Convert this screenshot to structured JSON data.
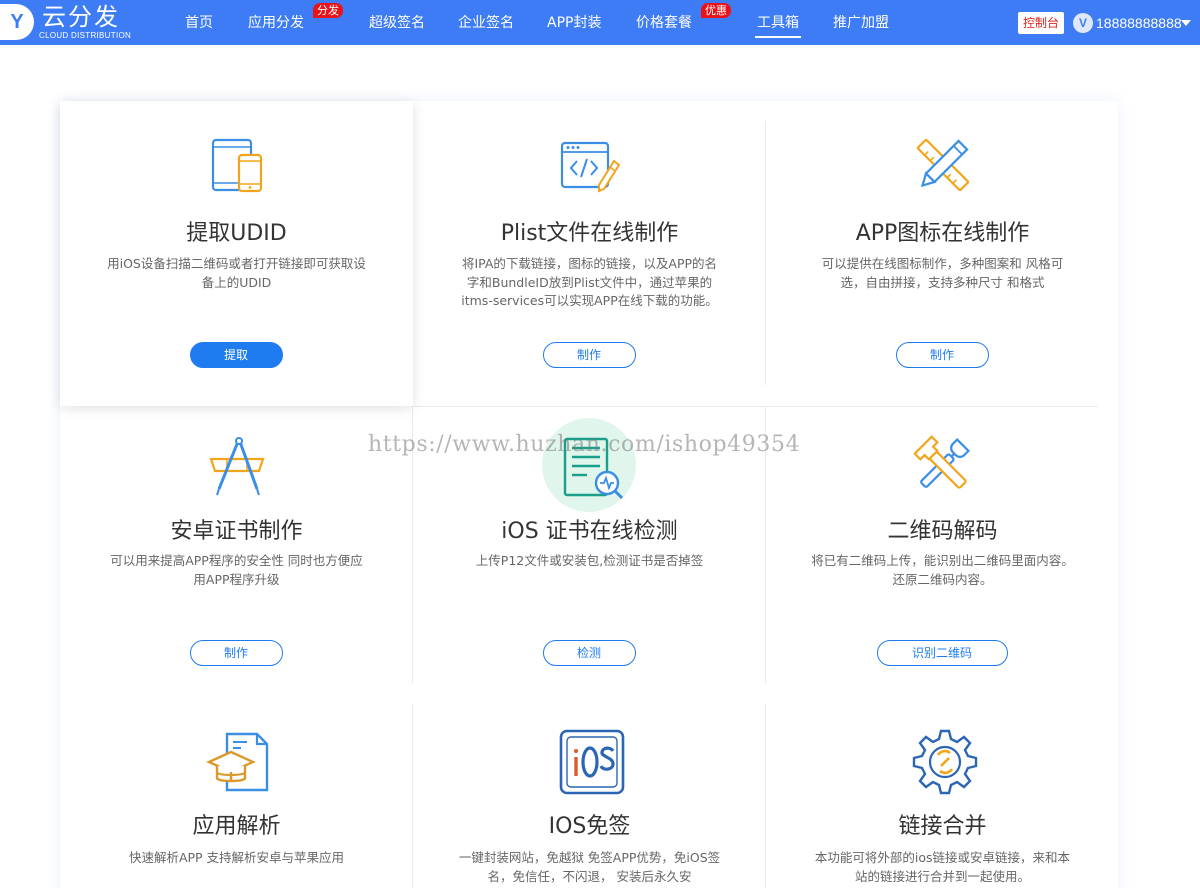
{
  "brand": {
    "badge": "Y",
    "name": "云分发",
    "subtitle": "CLOUD DISTRIBUTION",
    "color": "#3d7cf5"
  },
  "nav": {
    "items": [
      {
        "label": "首页"
      },
      {
        "label": "应用分发",
        "badge": "分发"
      },
      {
        "label": "超级签名"
      },
      {
        "label": "企业签名"
      },
      {
        "label": "APP封装"
      },
      {
        "label": "价格套餐",
        "badge": "优惠"
      },
      {
        "label": "工具箱",
        "active": true
      },
      {
        "label": "推广加盟"
      }
    ],
    "console_label": "控制台",
    "avatar_letter": "V",
    "username": "18888888888"
  },
  "watermark": "https://www.huzhan.com/ishop49354",
  "tools": [
    {
      "icon": "ipad-iphone-icon",
      "title": "提取UDID",
      "desc": "用iOS设备扫描二维码或者打开链接即可获取设备上的UDID",
      "button": "提取",
      "primary": true
    },
    {
      "icon": "code-file-pencil-icon",
      "title": "Plist文件在线制作",
      "desc": "将IPA的下载链接，图标的链接，以及APP的名字和BundleID放到Plist文件中，通过苹果的itms-services可以实现APP在线下载的功能。",
      "button": "制作"
    },
    {
      "icon": "pencil-ruler-icon",
      "title": "APP图标在线制作",
      "desc": "可以提供在线图标制作，多种图案和 风格可选，自由拼接，支持多种尺寸 和格式",
      "button": "制作"
    },
    {
      "icon": "compass-drawing-icon",
      "title": "安卓证书制作",
      "desc": "可以用来提高APP程序的安全性 同时也方便应用APP程序升级",
      "button": "制作"
    },
    {
      "icon": "document-search-icon",
      "title": "iOS 证书在线检测",
      "desc": "上传P12文件或安装包,检测证书是否掉签",
      "button": "检测"
    },
    {
      "icon": "hammer-wrench-icon",
      "title": "二维码解码",
      "desc": "将已有二维码上传，能识别出二维码里面内容。 还原二维码内容。",
      "button": "识别二维码"
    },
    {
      "icon": "graduation-document-icon",
      "title": "应用解析",
      "desc": "快速解析APP 支持解析安卓与苹果应用"
    },
    {
      "icon": "ios-badge-icon",
      "title": "IOS免签",
      "desc": "一键封装网站，免越狱 免签APP优势，免iOS签名，免信任，不闪退， 安装后永久安"
    },
    {
      "icon": "gear-link-icon",
      "title": "链接合并",
      "desc": "本功能可将外部的ios链接或安卓链接，来和本站的链接进行合并到一起使用。"
    }
  ]
}
